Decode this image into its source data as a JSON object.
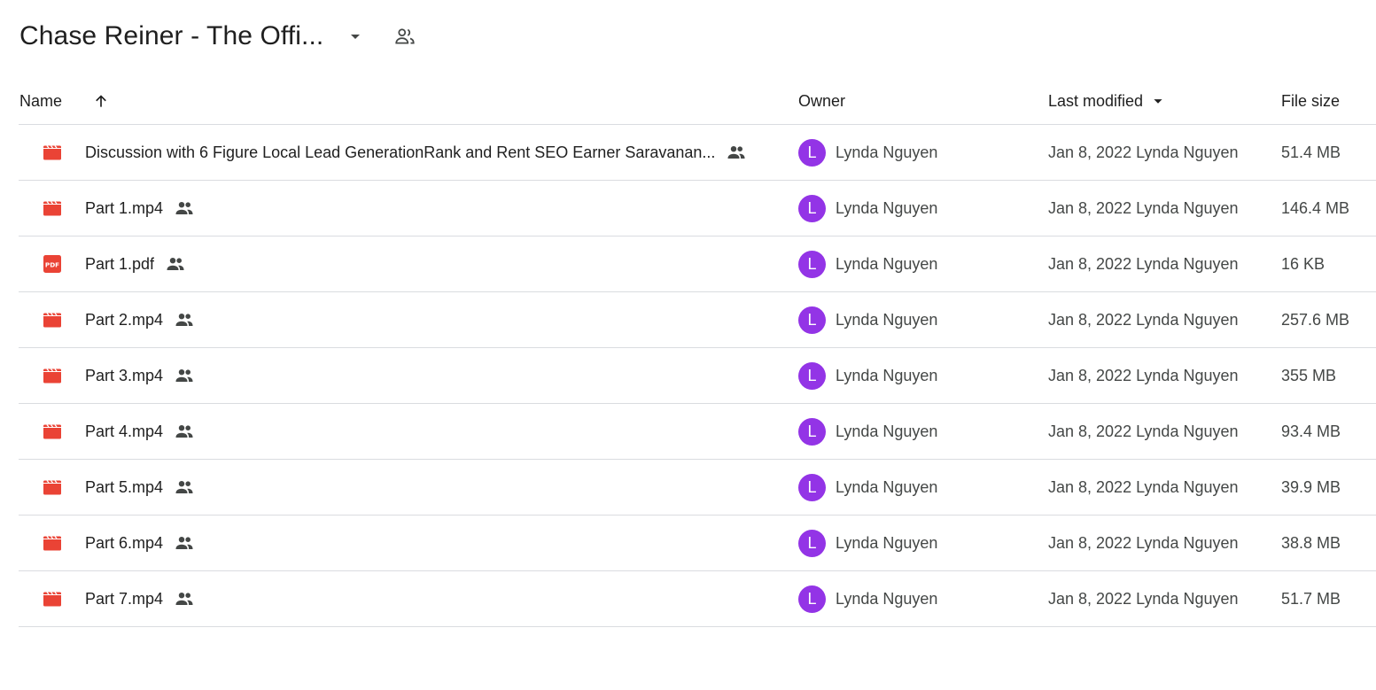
{
  "header": {
    "folder_title": "Chase Reiner - The Offi...",
    "dropdown_icon": "arrow-drop-down-icon",
    "share_icon": "people-outline-icon"
  },
  "columns": {
    "name": "Name",
    "owner": "Owner",
    "last_modified": "Last modified",
    "file_size": "File size",
    "sort_icon": "arrow-up-icon"
  },
  "colors": {
    "file_icon_red": "#ea4335",
    "avatar_purple": "#9334e6",
    "divider": "#dadce0"
  },
  "files": [
    {
      "name": "Discussion with 6 Figure Local Lead GenerationRank and Rent SEO Earner Saravanan...",
      "type": "video",
      "owner_initial": "L",
      "owner": "Lynda Nguyen",
      "modified": "Jan 8, 2022 Lynda Nguyen",
      "size": "51.4 MB"
    },
    {
      "name": "Part 1.mp4",
      "type": "video",
      "owner_initial": "L",
      "owner": "Lynda Nguyen",
      "modified": "Jan 8, 2022 Lynda Nguyen",
      "size": "146.4 MB"
    },
    {
      "name": "Part 1.pdf",
      "type": "pdf",
      "owner_initial": "L",
      "owner": "Lynda Nguyen",
      "modified": "Jan 8, 2022 Lynda Nguyen",
      "size": "16 KB"
    },
    {
      "name": "Part 2.mp4",
      "type": "video",
      "owner_initial": "L",
      "owner": "Lynda Nguyen",
      "modified": "Jan 8, 2022 Lynda Nguyen",
      "size": "257.6 MB"
    },
    {
      "name": "Part 3.mp4",
      "type": "video",
      "owner_initial": "L",
      "owner": "Lynda Nguyen",
      "modified": "Jan 8, 2022 Lynda Nguyen",
      "size": "355 MB"
    },
    {
      "name": "Part 4.mp4",
      "type": "video",
      "owner_initial": "L",
      "owner": "Lynda Nguyen",
      "modified": "Jan 8, 2022 Lynda Nguyen",
      "size": "93.4 MB"
    },
    {
      "name": "Part 5.mp4",
      "type": "video",
      "owner_initial": "L",
      "owner": "Lynda Nguyen",
      "modified": "Jan 8, 2022 Lynda Nguyen",
      "size": "39.9 MB"
    },
    {
      "name": "Part 6.mp4",
      "type": "video",
      "owner_initial": "L",
      "owner": "Lynda Nguyen",
      "modified": "Jan 8, 2022 Lynda Nguyen",
      "size": "38.8 MB"
    },
    {
      "name": "Part 7.mp4",
      "type": "video",
      "owner_initial": "L",
      "owner": "Lynda Nguyen",
      "modified": "Jan 8, 2022 Lynda Nguyen",
      "size": "51.7 MB"
    }
  ]
}
